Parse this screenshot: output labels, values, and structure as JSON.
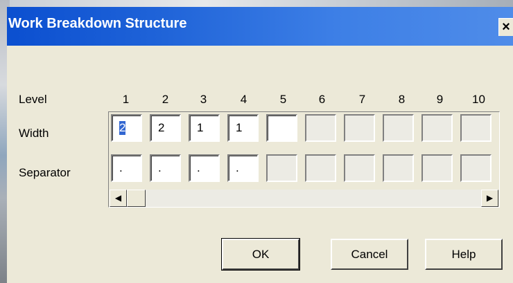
{
  "dialog": {
    "title": "Work Breakdown Structure",
    "close_label": "×"
  },
  "grid": {
    "level_label": "Level",
    "width_label": "Width",
    "separator_label": "Separator",
    "levels": [
      "1",
      "2",
      "3",
      "4",
      "5",
      "6",
      "7",
      "8",
      "9",
      "10"
    ],
    "widths": [
      "2",
      "2",
      "1",
      "1",
      "",
      "",
      "",
      "",
      "",
      ""
    ],
    "separators": [
      ".",
      ".",
      ".",
      ".",
      "",
      "",
      "",
      "",
      "",
      ""
    ]
  },
  "scrollbar": {
    "left_arrow": "◀",
    "right_arrow": "▶"
  },
  "buttons": {
    "ok": "OK",
    "cancel": "Cancel",
    "help": "Help"
  },
  "colors": {
    "titlebar": "#0b4fd0",
    "face": "#ece9d8",
    "selection": "#316ac5"
  }
}
